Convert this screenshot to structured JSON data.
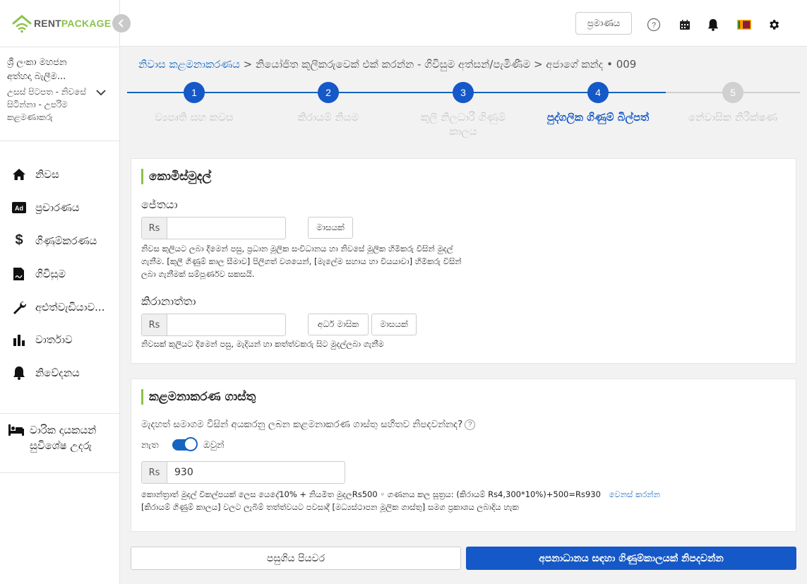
{
  "brand": {
    "name_part1": "RENT",
    "name_part2": "PACKAGE",
    "colors": {
      "green": "#8bc34a",
      "blue": "#1565c0"
    }
  },
  "sidebar": {
    "account_name": "ශ්‍රී ලංකා මහජන අත්හදා බැලීම...",
    "account_role": "උසස් පිටපත - නිවසේ සිටින්නා - උපරිම කළමණාකරු",
    "items": [
      {
        "icon": "home-icon",
        "label": "නිවස"
      },
      {
        "icon": "ad-icon",
        "label": "ප්‍රචාරණය"
      },
      {
        "icon": "dollar-icon",
        "label": "ගිණුම්කරණය"
      },
      {
        "icon": "contract-icon",
        "label": "ගිවිසුම"
      },
      {
        "icon": "wrench-icon",
        "label": "අළුත්වැඩියාව..."
      },
      {
        "icon": "bar-chart-icon",
        "label": "වාර්තාව"
      },
      {
        "icon": "bell-icon",
        "label": "නිවේදනය"
      }
    ],
    "bottom_item": {
      "icon": "bed-icon",
      "label": "වාරික දායකයන් සුවිශේෂ උදරු"
    }
  },
  "topbar": {
    "ad_button": "ප්‍රමාණය"
  },
  "breadcrumb": {
    "link": "නිවාස කළමනාකරණය",
    "rest": " > නියෝජිත කුලීකරුවෙක් එක් කරන්න - ගිවිසුම අත්සන්/පැමිණීම > අජාගේ කන්ද • 009"
  },
  "steps": [
    {
      "num": "1",
      "label": "ව්‍යපෘති සහ කවස",
      "state": "done"
    },
    {
      "num": "2",
      "label": "කිරායම් නියම",
      "state": "done"
    },
    {
      "num": "3",
      "label": "කුලී නිලධාරී ගිණුම් කාලය",
      "state": "done"
    },
    {
      "num": "4",
      "label": "පුද්ගලික ගිණුම් බිල්පත්",
      "state": "active"
    },
    {
      "num": "5",
      "label": "නේවාසික නිරීක්ෂණ",
      "state": "todo"
    }
  ],
  "commission": {
    "title": "කොමිස්මුදල්",
    "agent_label": "ජේතයා",
    "agent_value": "",
    "agent_chip": "මාසයක්",
    "agent_desc": "නිවස කුලියට ලබා දීමෙන් පසු, ප්‍රධාන මූලික සංවිධානය හා නිවසේ මූලික හිමිකරු විසින් මුදල් ගැනීම. [කුලී ගිණුම් කාල සීමාව] පිලිගත් වශයෙන්, [මැලේම සහාය හා වියයාවා] හිමිකරු විසින් ලබා ගැනීමක් සම්පූර්ණව සකසයි.",
    "tenant_label": "කිරානාත්තා",
    "tenant_value": "",
    "tenant_chip1": "අර්ධ මාසික",
    "tenant_chip2": "මාසයක්",
    "tenant_desc": "නිවසක් කුලියට දීමෙන් පසු, මැදියන් හා කත්ත්වකරු සිට මුදල්ලබා ගැනීම",
    "currency": "Rs"
  },
  "mgmt": {
    "title": "කළමනාකරණ ගාස්තු",
    "question": "මැදහත් සමාගම විසින් අයකරනු ලබන කළමනාකරණ ගාස්තු සහිතව නිපදවන්නද?",
    "toggle_off": "නැත",
    "toggle_on": "ඔවුන්",
    "fee_value": "930",
    "desc1": "කොන්ත්‍රාත් මුදල් විකල්පයක් ලෙස යෙදේ10% + නියමිත මුදලRs500 ◦ ගණනය කල සූත්‍රය: (කිරායම් Rs4,300*10%)+500=Rs930",
    "desc1_link": "වෙනස් කරන්න",
    "desc2": "[කිරායම් ගිණුම් කාලය] වලට ලැබීම් තත්ත්වයට පවසාදී [මධ්‍යස්ථාපන මූලික ගාස්තු] සමග ප්‍රකාශය ලබාදිය හැක"
  },
  "buttons": {
    "back": "පසුගිය පියවර",
    "next": "අපනාධානය සඳහා ගිණුම්කාලයක් නිපදවන්න"
  }
}
